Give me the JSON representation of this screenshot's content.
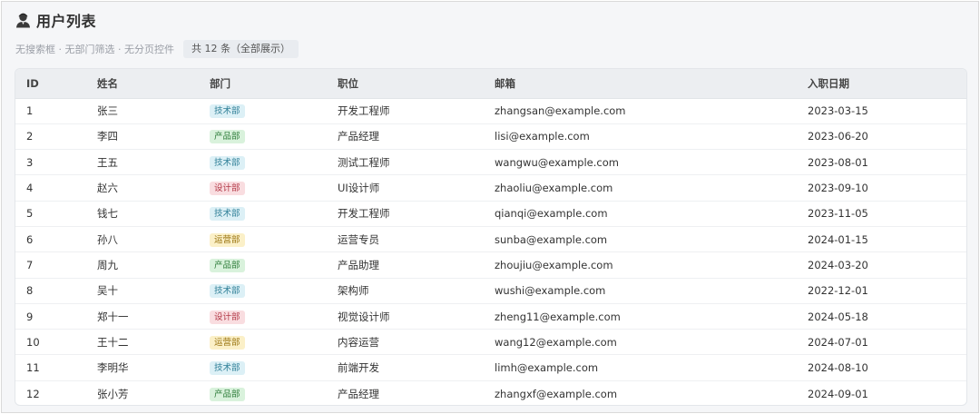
{
  "header": {
    "title": "用户列表",
    "icon": "user-icon"
  },
  "subline": {
    "note": "无搜索框 · 无部门筛选 · 无分页控件",
    "total": "共 12 条（全部展示）"
  },
  "table": {
    "columns": [
      "ID",
      "姓名",
      "部门",
      "职位",
      "邮箱",
      "入职日期"
    ],
    "rows": [
      {
        "id": "1",
        "name": "张三",
        "dept": "技术部",
        "dept_type": "tech",
        "title": "开发工程师",
        "email": "zhangsan@example.com",
        "date": "2023-03-15"
      },
      {
        "id": "2",
        "name": "李四",
        "dept": "产品部",
        "dept_type": "prod",
        "title": "产品经理",
        "email": "lisi@example.com",
        "date": "2023-06-20"
      },
      {
        "id": "3",
        "name": "王五",
        "dept": "技术部",
        "dept_type": "tech",
        "title": "测试工程师",
        "email": "wangwu@example.com",
        "date": "2023-08-01"
      },
      {
        "id": "4",
        "name": "赵六",
        "dept": "设计部",
        "dept_type": "design",
        "title": "UI设计师",
        "email": "zhaoliu@example.com",
        "date": "2023-09-10"
      },
      {
        "id": "5",
        "name": "钱七",
        "dept": "技术部",
        "dept_type": "tech",
        "title": "开发工程师",
        "email": "qianqi@example.com",
        "date": "2023-11-05"
      },
      {
        "id": "6",
        "name": "孙八",
        "dept": "运营部",
        "dept_type": "ops",
        "title": "运营专员",
        "email": "sunba@example.com",
        "date": "2024-01-15"
      },
      {
        "id": "7",
        "name": "周九",
        "dept": "产品部",
        "dept_type": "prod",
        "title": "产品助理",
        "email": "zhoujiu@example.com",
        "date": "2024-03-20"
      },
      {
        "id": "8",
        "name": "吴十",
        "dept": "技术部",
        "dept_type": "tech",
        "title": "架构师",
        "email": "wushi@example.com",
        "date": "2022-12-01"
      },
      {
        "id": "9",
        "name": "郑十一",
        "dept": "设计部",
        "dept_type": "design",
        "title": "视觉设计师",
        "email": "zheng11@example.com",
        "date": "2024-05-18"
      },
      {
        "id": "10",
        "name": "王十二",
        "dept": "运营部",
        "dept_type": "ops",
        "title": "内容运营",
        "email": "wang12@example.com",
        "date": "2024-07-01"
      },
      {
        "id": "11",
        "name": "李明华",
        "dept": "技术部",
        "dept_type": "tech",
        "title": "前端开发",
        "email": "limh@example.com",
        "date": "2024-08-10"
      },
      {
        "id": "12",
        "name": "张小芳",
        "dept": "产品部",
        "dept_type": "prod",
        "title": "产品经理",
        "email": "zhangxf@example.com",
        "date": "2024-09-01"
      }
    ]
  },
  "colors": {
    "tech": "#2f7f97",
    "prod": "#2e7d3a",
    "design": "#b33a48",
    "ops": "#9a7410"
  }
}
